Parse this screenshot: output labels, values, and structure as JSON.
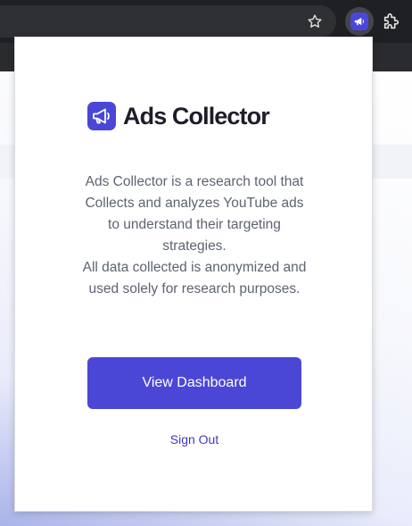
{
  "browser": {
    "icons": [
      "star-icon",
      "megaphone-icon",
      "puzzle-icon"
    ],
    "active_extension_color": "#4b47d6"
  },
  "popup": {
    "brand": {
      "name": "Ads Collector",
      "logo_icon": "megaphone-icon",
      "logo_color": "#4b47d6"
    },
    "description": {
      "line1": "Ads Collector is a research tool that Collects and analyzes YouTube ads to understand their targeting strategies.",
      "line2": "All data collected is anonymized and used solely for research purposes."
    },
    "dashboard_button": {
      "label": "View Dashboard",
      "color": "#4b47d6"
    },
    "signout_link": {
      "label": "Sign Out"
    }
  }
}
